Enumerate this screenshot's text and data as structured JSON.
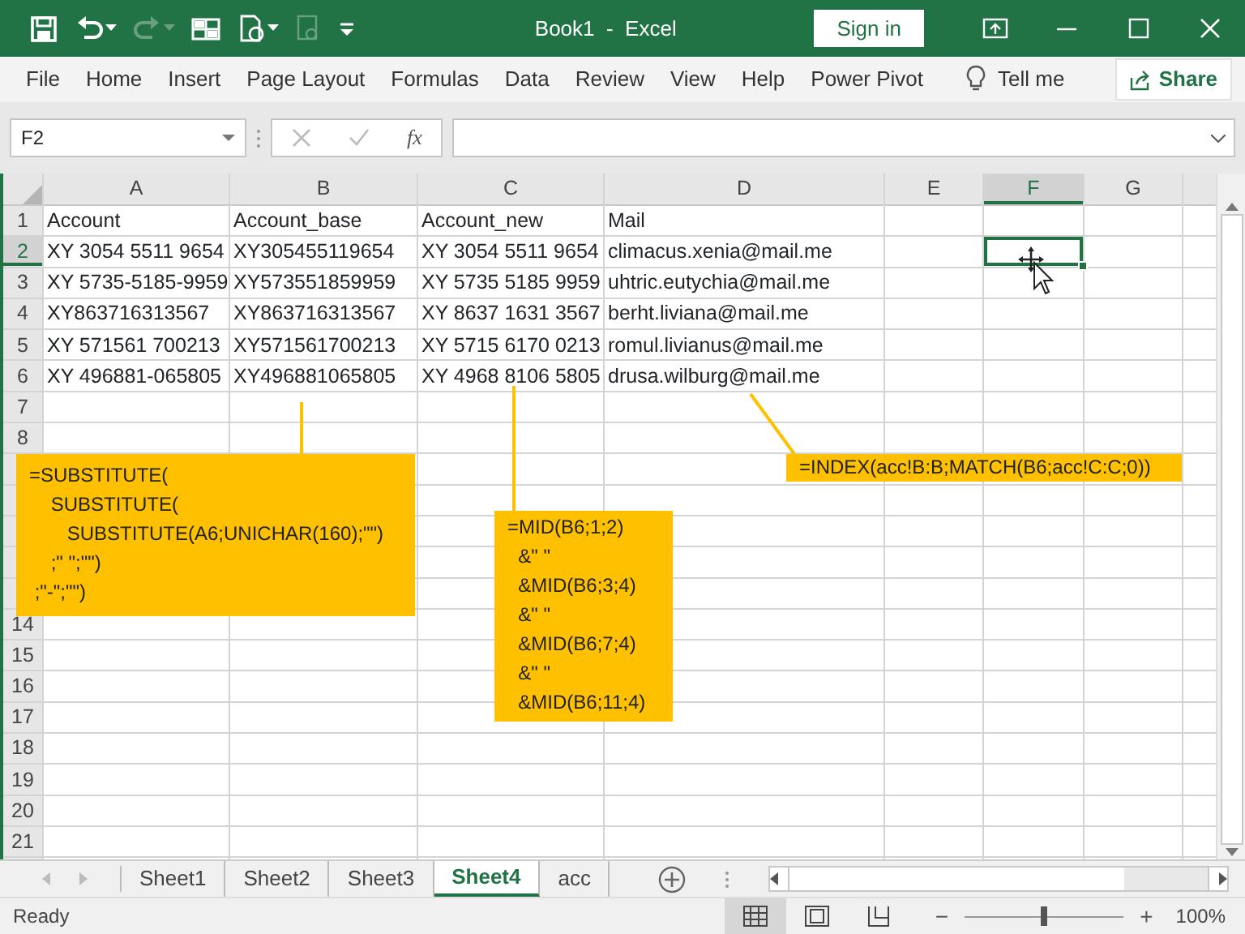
{
  "title_bar": {
    "title": "Book1  -  Excel",
    "sign_in": "Sign in",
    "quick_access": [
      {
        "kind": "save",
        "disabled": false,
        "caret": false
      },
      {
        "kind": "undo",
        "disabled": false,
        "caret": true
      },
      {
        "kind": "redo",
        "disabled": true,
        "caret": true
      },
      {
        "kind": "form",
        "disabled": false,
        "caret": false
      },
      {
        "kind": "refresh",
        "disabled": false,
        "caret": true
      },
      {
        "kind": "link",
        "disabled": true,
        "caret": false
      },
      {
        "kind": "customize",
        "disabled": false,
        "caret": false
      }
    ]
  },
  "ribbon": {
    "tabs": [
      {
        "label": "File"
      },
      {
        "label": "Home"
      },
      {
        "label": "Insert"
      },
      {
        "label": "Page Layout"
      },
      {
        "label": "Formulas"
      },
      {
        "label": "Data"
      },
      {
        "label": "Review"
      },
      {
        "label": "View"
      },
      {
        "label": "Help"
      },
      {
        "label": "Power Pivot"
      }
    ],
    "tell_me": "Tell me",
    "share": "Share"
  },
  "formula_bar": {
    "name_box": "F2",
    "fx": "fx"
  },
  "grid": {
    "columns": [
      {
        "label": "A",
        "selected": false
      },
      {
        "label": "B",
        "selected": false
      },
      {
        "label": "C",
        "selected": false
      },
      {
        "label": "D",
        "selected": false
      },
      {
        "label": "E",
        "selected": false
      },
      {
        "label": "F",
        "selected": true
      },
      {
        "label": "G",
        "selected": false
      }
    ],
    "rows": [
      {
        "header": "1",
        "selected": false,
        "cells": [
          "Account",
          "Account_base",
          "Account_new",
          "Mail"
        ]
      },
      {
        "header": "2",
        "selected": true,
        "cells": [
          "XY 3054 5511 9654",
          "XY305455119654",
          "XY 3054 5511 9654",
          "climacus.xenia@mail.me"
        ]
      },
      {
        "header": "3",
        "selected": false,
        "cells": [
          "XY 5735-5185-9959",
          "XY573551859959",
          "XY 5735 5185 9959",
          "uhtric.eutychia@mail.me"
        ]
      },
      {
        "header": "4",
        "selected": false,
        "cells": [
          "XY863716313567",
          "XY863716313567",
          "XY 8637 1631 3567",
          "berht.liviana@mail.me"
        ]
      },
      {
        "header": "5",
        "selected": false,
        "cells": [
          "XY 571561 700213",
          "XY571561700213",
          "XY 5715 6170 0213",
          "romul.livianus@mail.me"
        ]
      },
      {
        "header": "6",
        "selected": false,
        "cells": [
          "XY 496881-065805",
          "XY496881065805",
          "XY 4968 8106 5805",
          "drusa.wilburg@mail.me"
        ]
      },
      {
        "header": "7",
        "selected": false
      },
      {
        "header": "8",
        "selected": false
      },
      {},
      {},
      {},
      {},
      {},
      {
        "header": "14",
        "selected": false
      },
      {
        "header": "15",
        "selected": false
      },
      {
        "header": "16",
        "selected": false
      },
      {
        "header": "17",
        "selected": false
      },
      {
        "header": "18",
        "selected": false
      },
      {
        "header": "19",
        "selected": false
      },
      {
        "header": "20",
        "selected": false
      },
      {
        "header": "21",
        "selected": false
      }
    ]
  },
  "callouts": [
    {
      "lines": [
        "=SUBSTITUTE(",
        "    SUBSTITUTE(",
        "       SUBSTITUTE(A6;UNICHAR(160);\"\")",
        "    ;\" \";\"\")",
        " ;\"-\";\"\")"
      ]
    },
    {
      "lines": [
        "=MID(B6;1;2)",
        "  &\" \"",
        "  &MID(B6;3;4)",
        "  &\" \"",
        "  &MID(B6;7;4)",
        "  &\" \"",
        "  &MID(B6;11;4)"
      ]
    },
    {
      "lines": [
        "=INDEX(acc!B:B;MATCH(B6;acc!C:C;0))"
      ]
    }
  ],
  "sheet_tabs": [
    {
      "label": "Sheet1",
      "selected": false
    },
    {
      "label": "Sheet2",
      "selected": false
    },
    {
      "label": "Sheet3",
      "selected": false
    },
    {
      "label": "Sheet4",
      "selected": true
    },
    {
      "label": "acc",
      "selected": false
    }
  ],
  "status_bar": {
    "text": "Ready",
    "views": [
      {
        "kind": "normal",
        "selected": true
      },
      {
        "kind": "page_layout",
        "selected": false
      },
      {
        "kind": "page_break",
        "selected": false
      }
    ],
    "zoom_out": "−",
    "zoom_in": "+",
    "zoom": {
      "level": 0.5
    },
    "zoom_reading": "100%"
  }
}
